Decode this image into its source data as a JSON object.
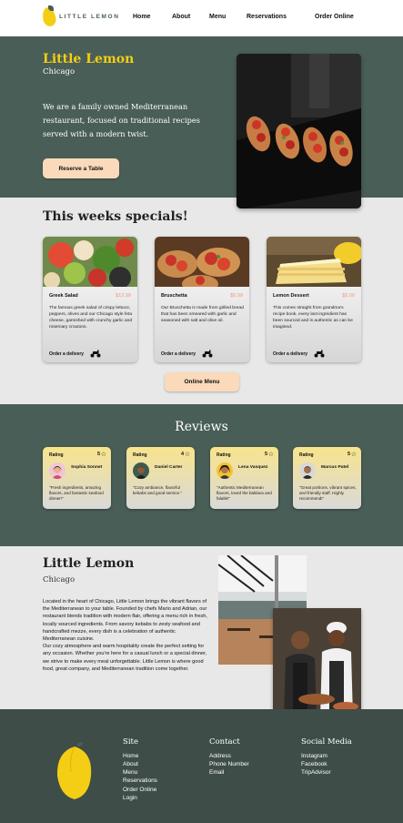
{
  "nav": {
    "logo_text": "LITTLE LEMON",
    "links": [
      "Home",
      "About",
      "Menu",
      "Reservations",
      "Order Online"
    ]
  },
  "hero": {
    "title": "Little Lemon",
    "subtitle": "Chicago",
    "description": "We are a family owned Mediterranean restaurant, focused on traditional recipes served with a modern twist.",
    "button": "Reserve a Table"
  },
  "specials": {
    "title": "This weeks specials!",
    "button": "Online Menu",
    "items": [
      {
        "name": "Greek Salad",
        "price": "$12.99",
        "description": "The famous greek salad of crispy lettuce, peppers, olives and our Chicago style feta cheese, garnished with crunchy garlic and rosemary croutons.",
        "order": "Order a delivery"
      },
      {
        "name": "Bruschetta",
        "price": "$5.99",
        "description": "Our Bruschetta is made from grilled bread that has been smeared with garlic and seasoned with salt and olive oil.",
        "order": "Order a delivery"
      },
      {
        "name": "Lemon Dessert",
        "price": "$5.00",
        "description": "This comes straight from grandma's recipe book, every last ingredient has been sourced and is authentic as can be imagined.",
        "order": "Order a delivery"
      }
    ]
  },
  "reviews": {
    "title": "Reviews",
    "items": [
      {
        "label": "Rating",
        "score": "5",
        "name": "Sophia Sonnet",
        "quote": "\"Fresh ingredients, amazing flavors, and fantastic seafood dinner!\""
      },
      {
        "label": "Rating",
        "score": "4",
        "name": "Daniel Carter",
        "quote": "\"Cozy ambiance, flavorful kebabs and good service.\""
      },
      {
        "label": "Rating",
        "score": "5",
        "name": "Lena Vasquez",
        "quote": "\"Authentic Mediterranean flavors, loved the baklava and falafel!\""
      },
      {
        "label": "Rating",
        "score": "5",
        "name": "Marcus Patel",
        "quote": "\"Great portions, vibrant spices, and friendly staff. Highly recommend!\""
      }
    ]
  },
  "about": {
    "title": "Little Lemon",
    "subtitle": "Chicago",
    "description": "Located in the heart of Chicago, Little Lemon brings the vibrant flavors of the Mediterranean to your table. Founded by chefs Mario and Adrian, our restaurant blends tradition with modern flair, offering a menu rich in fresh, locally sourced ingredients. From savory kebabs to zesty seafood and handcrafted mezze, every dish is a celebration of authentic Mediterranean cuisine.\nOur cozy atmosphere and warm hospitality create the perfect setting for any occasion. Whether you're here for a casual lunch or a special dinner, we strive to make every meal unforgettable. Little Lemon is where good food, great company, and Mediterranean tradition come together."
  },
  "footer": {
    "site": {
      "title": "Site",
      "links": [
        "Home",
        "About",
        "Menu",
        "Reservations",
        "Order Online",
        "Login"
      ]
    },
    "contact": {
      "title": "Contact",
      "links": [
        "Address",
        "Phone Number",
        "Email"
      ]
    },
    "social": {
      "title": "Social Media",
      "links": [
        "Instagram",
        "Facebook",
        "TripAdvisor"
      ]
    }
  },
  "colors": {
    "primary_green": "#495e57",
    "yellow": "#f4ce14",
    "peach": "#fbdabb",
    "salmon": "#ee9972"
  }
}
